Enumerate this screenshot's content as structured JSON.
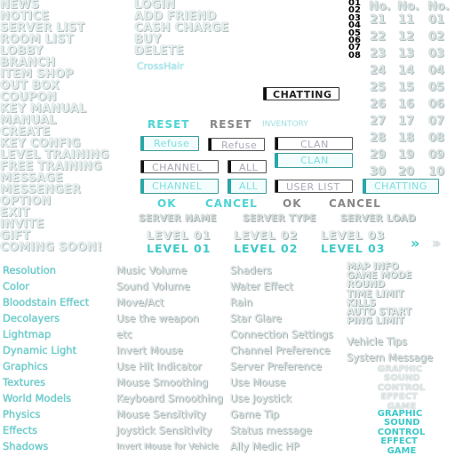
{
  "left_menu": [
    "NEWS",
    "NOTICE",
    "SERVER LIST",
    "ROOM LIST",
    "LOBBY",
    "BRANCH",
    "ITEM SHOP",
    "OUT BOX",
    "COUPON",
    "KEY MANUAL",
    "MANUAL",
    "CREATE",
    "KEY CONFIG",
    "LEVEL TRAINING",
    "FREE TRAINING",
    "MESSAGE",
    "MESSENGER",
    "OPTION",
    "EXIT",
    "INVITE",
    "GIFT",
    "COMING SOON!"
  ],
  "center_menu": [
    "LOGIN",
    "ADD FRIEND",
    "CASH CHARGE",
    "BUY",
    "DELETE"
  ],
  "crosshair": "CrossHair",
  "rank_numbers": [
    "01",
    "02",
    "03",
    "04",
    "05",
    "06",
    "07",
    "08"
  ],
  "no_headers": [
    "No.",
    "No.",
    "No."
  ],
  "no_columns": [
    [
      "21",
      "22",
      "23",
      "24",
      "25",
      "26",
      "27",
      "28",
      "29",
      "30"
    ],
    [
      "11",
      "12",
      "13",
      "14",
      "15",
      "16",
      "17",
      "18",
      "19",
      "20"
    ],
    [
      "01",
      "02",
      "03",
      "04",
      "05",
      "06",
      "07",
      "08",
      "09",
      "10"
    ]
  ],
  "chatting": "CHATTING",
  "reset_cyan": "RESET",
  "reset_gray": "RESET",
  "inventory": "INVENTORY",
  "refuse_active": "Refuse",
  "refuse": "Refuse",
  "clan": "CLAN",
  "clan_active": "CLAN",
  "channel": "CHANNEL",
  "all": "ALL",
  "channel_active": "CHANNEL",
  "all_active": "ALL",
  "user_list": "USER LIST",
  "chatting_active": "CHATTING",
  "ok_cyan": "OK",
  "cancel_cyan": "CANCEL",
  "ok_gray": "OK",
  "cancel_gray": "CANCEL",
  "server_headers": [
    "SERVER NAME",
    "SERVER TYPE",
    "SERVER LOAD"
  ],
  "levels_light": [
    "LEVEL 01",
    "LEVEL 02",
    "LEVEL 03"
  ],
  "levels_cyan": [
    "LEVEL 01",
    "LEVEL 02",
    "LEVEL 03"
  ],
  "options_col1": [
    "Resolution",
    "Color",
    "Bloodstain Effect",
    "Decolayers",
    "Lightmap",
    "Dynamic Light",
    "Graphics",
    "Textures",
    "World Models",
    "Physics",
    "Effects",
    "Shadows"
  ],
  "options_col2": [
    "Music Volume",
    "Sound Volume",
    "Move/Act",
    "Use the weapon",
    "etc",
    "Invert Mouse",
    "Use Hit Indicator",
    "Mouse Smoothing",
    "Keyboard Smoothing",
    "Mouse Sensitivity",
    "Joystick Sensitivity",
    "Invert Mouse for Vehicle"
  ],
  "options_col3": [
    "Shaders",
    "Water Effect",
    "Rain",
    "Star Glare",
    "Connection Settings",
    "Channel Preference",
    "Server Preference",
    "Use Mouse",
    "Use Joystick",
    "Game Tip",
    "Status message",
    "Ally Medic HP"
  ],
  "map_info": [
    "MAP INFO",
    "GAME MODE",
    "ROUND",
    "TIME LIMIT",
    "KILLS",
    "AUTO START",
    "PING LIMIT"
  ],
  "vehicle_tips": "Vehicle Tips",
  "system_message": "System Message",
  "tabs_gray": [
    "GRAPHIC",
    "SOUND",
    "CONTROL",
    "EFFECT",
    "GAME"
  ],
  "tabs_cyan": [
    "GRAPHIC",
    "SOUND",
    "CONTROL",
    "EFFECT",
    "GAME"
  ],
  "colors": {
    "cyan": "#40d0d0",
    "gray": "#777777"
  }
}
